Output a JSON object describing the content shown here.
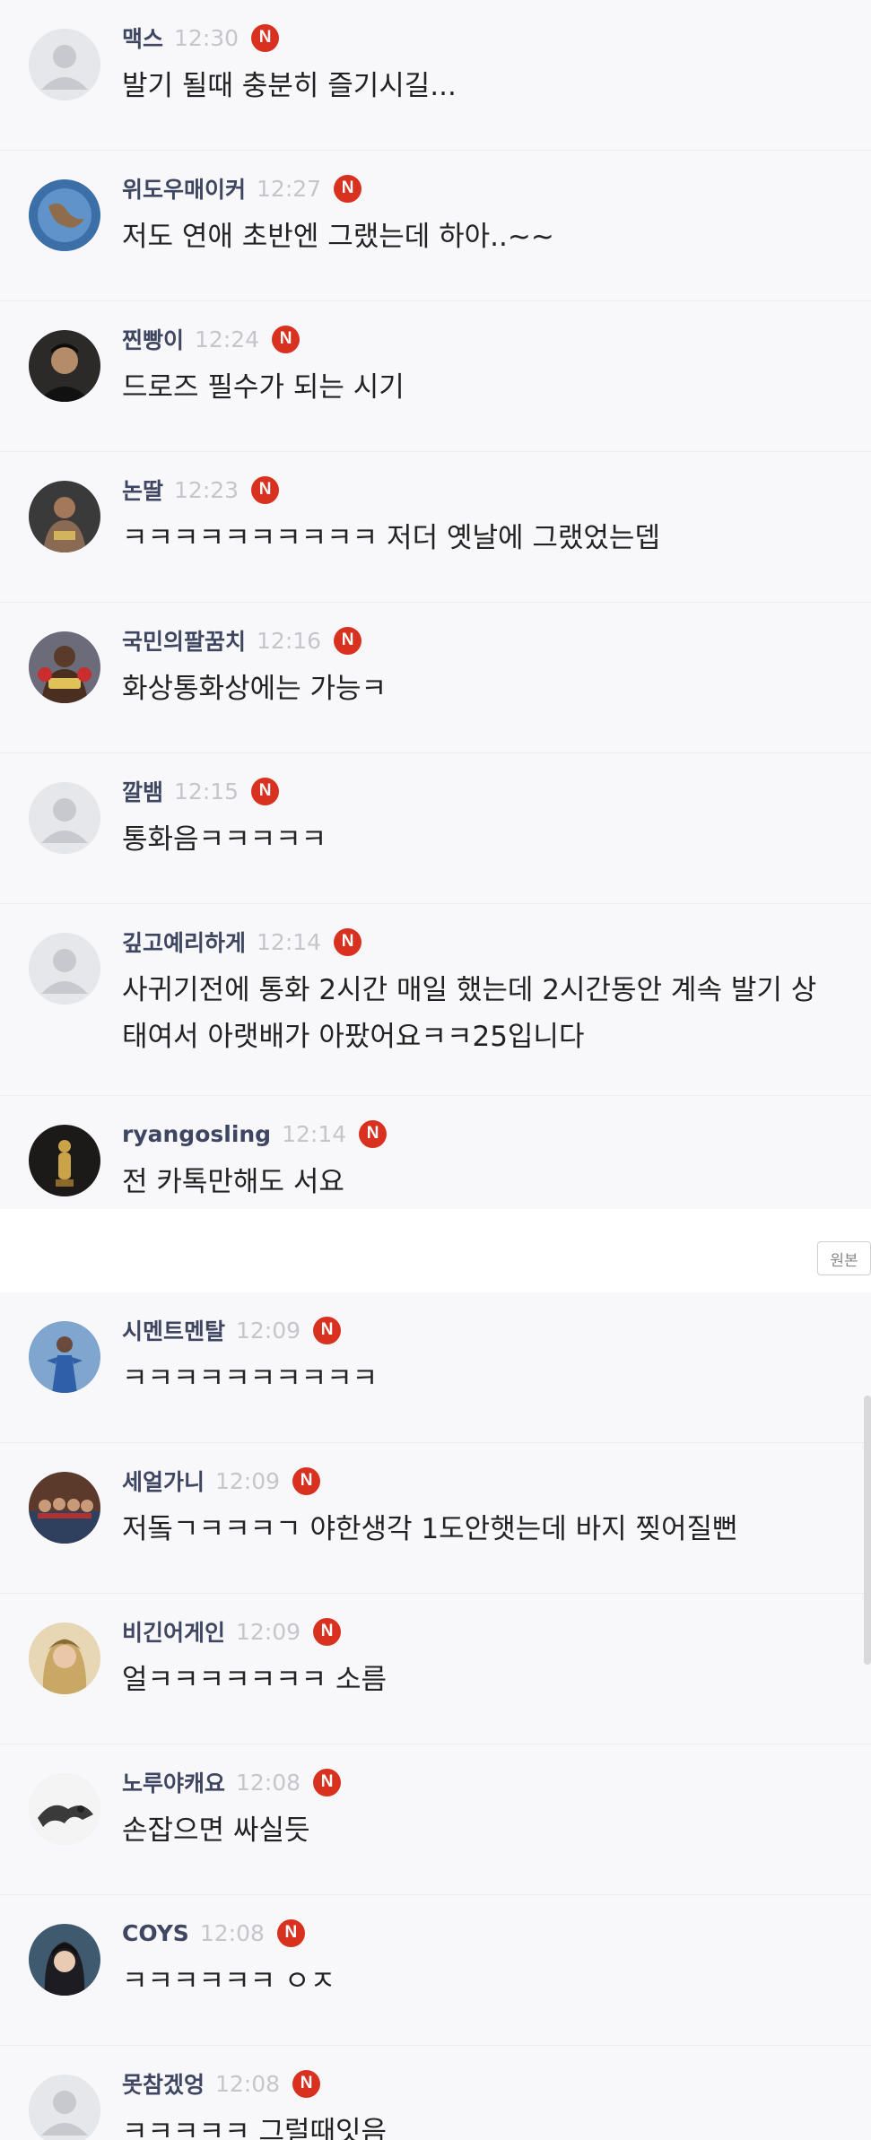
{
  "top_comments": [
    {
      "name": "맥스",
      "time": "12:30",
      "text": "발기 될때 충분히 즐기시길..."
    },
    {
      "name": "위도우매이커",
      "time": "12:27",
      "text": "저도 연애 초반엔 그랬는데 하아..~~"
    },
    {
      "name": "찐빵이",
      "time": "12:24",
      "text": "드로즈 필수가 되는 시기"
    },
    {
      "name": "논딸",
      "time": "12:23",
      "text": "ㅋㅋㅋㅋㅋㅋㅋㅋㅋㅋ 저더 옛날에 그랬었는뎁"
    },
    {
      "name": "국민의팔꿈치",
      "time": "12:16",
      "text": "화상통화상에는 가능ㅋ"
    },
    {
      "name": "깔뱀",
      "time": "12:15",
      "text": "통화음ㅋㅋㅋㅋㅋ"
    },
    {
      "name": "깊고예리하게",
      "time": "12:14",
      "text": "사귀기전에 통화 2시간 매일 했는데 2시간동안 계속 발기 상태여서 아랫배가 아팠어요ㅋㅋ25입니다"
    },
    {
      "name": "ryangosling",
      "time": "12:14",
      "text": "전 카톡만해도 서요"
    }
  ],
  "original_button_label": "원본",
  "bottom_comments": [
    {
      "name": "시멘트멘탈",
      "time": "12:09",
      "text": "ㅋㅋㅋㅋㅋㅋㅋㅋㅋㅋ"
    },
    {
      "name": "세얼가니",
      "time": "12:09",
      "text": "저돜ㄱㅋㅋㅋㄱ  야한생각 1도안햇는데 바지 찢어질뻔"
    },
    {
      "name": "비긴어게인",
      "time": "12:09",
      "text": "얼ㅋㅋㅋㅋㅋㅋㅋ 소름"
    },
    {
      "name": "노루야캐요",
      "time": "12:08",
      "text": "손잡으면 싸실듯"
    },
    {
      "name": "COYS",
      "time": "12:08",
      "text": "ㅋㅋㅋㅋㅋㅋ ㅇㅈ"
    },
    {
      "name": "못참겠엉",
      "time": "12:08",
      "text": "ㅋㅋㅋㅋㅋ 그럴때잇음"
    }
  ],
  "badge_letter": "N",
  "colors": {
    "badge": "#d8311f",
    "name": "#3f4661",
    "time": "#c4c6cc",
    "background": "#f8f8fa"
  }
}
